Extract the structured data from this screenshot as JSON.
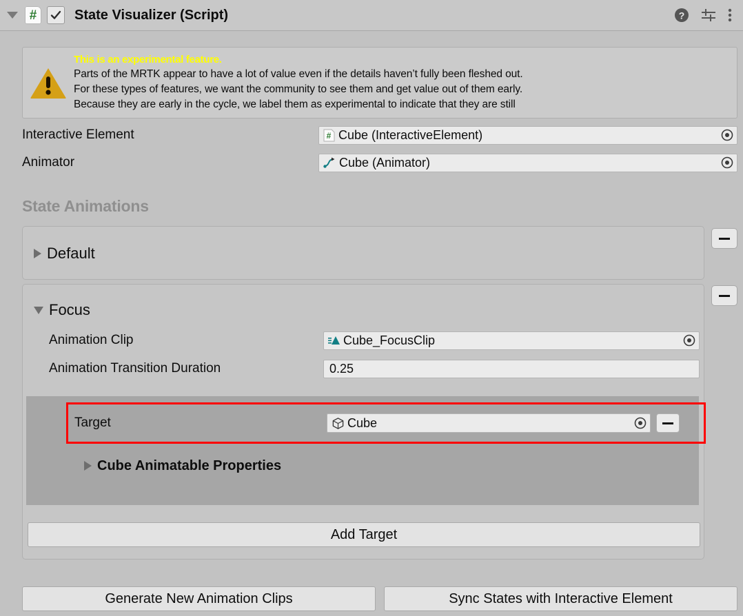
{
  "component": {
    "title": "State Visualizer (Script)",
    "script_icon": "csharp-script-icon",
    "enabled_checkbox": "checked",
    "foldout": "expanded",
    "help_icon": "help-icon",
    "preset_icon": "preset-sliders-icon",
    "menu_icon": "kebab-menu-icon"
  },
  "warning": {
    "icon": "warning-triangle-icon",
    "title": "This is an experimental feature.",
    "lines": [
      "Parts of the MRTK appear to have a lot of value even if the details haven’t fully been fleshed out.",
      "For these types of features, we want the community to see them and get value out of them early.",
      "Because they are early in the cycle, we label them as experimental to indicate that they are still"
    ]
  },
  "fields": {
    "interactive_element": {
      "label": "Interactive Element",
      "value": "Cube (InteractiveElement)",
      "icon": "csharp-script-icon",
      "picker": "object-picker-icon"
    },
    "animator": {
      "label": "Animator",
      "value": "Cube (Animator)",
      "icon": "animator-icon",
      "picker": "object-picker-icon"
    }
  },
  "state_animations": {
    "header": "State Animations",
    "states": [
      {
        "name": "Default",
        "expanded": false,
        "remove_label": "−"
      },
      {
        "name": "Focus",
        "expanded": true,
        "remove_label": "−",
        "animation_clip": {
          "label": "Animation Clip",
          "value": "Cube_FocusClip",
          "icon": "animation-clip-icon",
          "picker": "object-picker-icon"
        },
        "transition_duration": {
          "label": "Animation Transition Duration",
          "value": "0.25"
        },
        "target": {
          "label": "Target",
          "value": "Cube",
          "icon": "gameobject-cube-icon",
          "picker": "object-picker-icon",
          "remove_label": "−",
          "highlighted": true,
          "highlight_color": "#fe0000"
        },
        "animatable_properties": {
          "label": "Cube Animatable Properties",
          "expanded": false
        },
        "add_target_button": "Add Target"
      }
    ]
  },
  "bottom_buttons": {
    "generate": "Generate New Animation Clips",
    "sync": "Sync States with Interactive Element"
  },
  "colors": {
    "background": "#c2c2c2",
    "header": "#c8c8c8",
    "panel": "#c6c6c6",
    "target_panel": "#a6a6a6",
    "field": "#ebebeb",
    "warning_yellow": "#ffff00",
    "warning_icon": "#d5a017",
    "section_title": "#8f8f8f",
    "script_green": "#2e7d32",
    "teal": "#137f85"
  }
}
